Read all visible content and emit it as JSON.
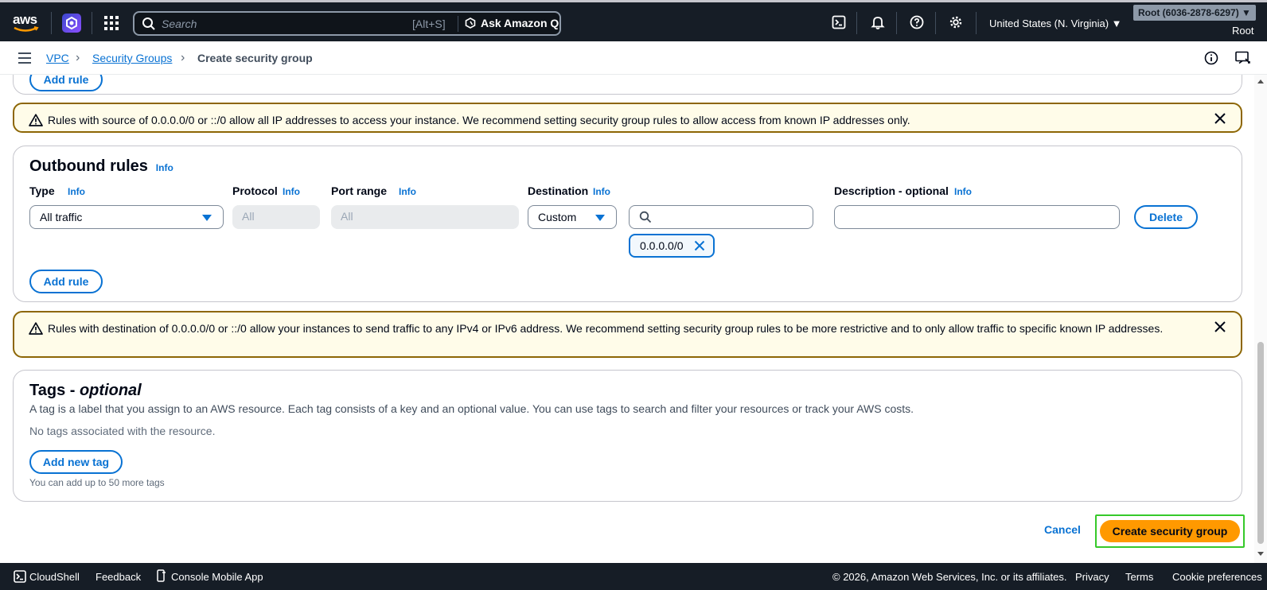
{
  "topnav": {
    "logo_text": "aws",
    "search_placeholder": "Search",
    "search_shortcut": "[Alt+S]",
    "ask_q_label": "Ask Amazon Q",
    "region_label": "United States (N. Virginia) ▼",
    "account_label": "Root (6036-2878-6297) ▼",
    "user_label": "Root"
  },
  "breadcrumb": {
    "items": [
      "VPC",
      "Security Groups",
      "Create security group"
    ]
  },
  "inbound": {
    "add_rule_label": "Add rule"
  },
  "inbound_alert": {
    "message": "Rules with source of 0.0.0.0/0 or ::/0 allow all IP addresses to access your instance. We recommend setting security group rules to allow access from known IP addresses only."
  },
  "outbound": {
    "title": "Outbound rules",
    "info": "Info",
    "columns": {
      "type": "Type",
      "protocol": "Protocol",
      "port_range": "Port range",
      "destination": "Destination",
      "description": "Description - optional"
    },
    "rule": {
      "type_value": "All traffic",
      "protocol_value": "All",
      "port_value": "All",
      "destination_value": "Custom",
      "cidr_token": "0.0.0.0/0",
      "delete_label": "Delete"
    },
    "add_rule_label": "Add rule"
  },
  "outbound_alert": {
    "message": "Rules with destination of 0.0.0.0/0 or ::/0 allow your instances to send traffic to any IPv4 or IPv6 address. We recommend setting security group rules to be more restrictive and to only allow traffic to specific known IP addresses."
  },
  "tags": {
    "title_main": "Tags - ",
    "title_optional": "optional",
    "description": "A tag is a label that you assign to an AWS resource. Each tag consists of a key and an optional value. You can use tags to search and filter your resources or track your AWS costs.",
    "empty_text": "No tags associated with the resource.",
    "add_tag_label": "Add new tag",
    "limit_text": "You can add up to 50 more tags"
  },
  "actions": {
    "cancel_label": "Cancel",
    "create_label": "Create security group"
  },
  "footer": {
    "cloudshell": "CloudShell",
    "feedback": "Feedback",
    "mobile_app": "Console Mobile App",
    "copyright": "© 2026, Amazon Web Services, Inc. or its affiliates.",
    "privacy": "Privacy",
    "terms": "Terms",
    "cookie": "Cookie preferences"
  },
  "colors": {
    "nav_bg": "#161d26",
    "link_blue": "#0972d3",
    "primary_orange": "#ff9900",
    "warning_border": "#8d6605",
    "warning_bg": "#fffce9",
    "highlight_green": "#36c92a"
  }
}
